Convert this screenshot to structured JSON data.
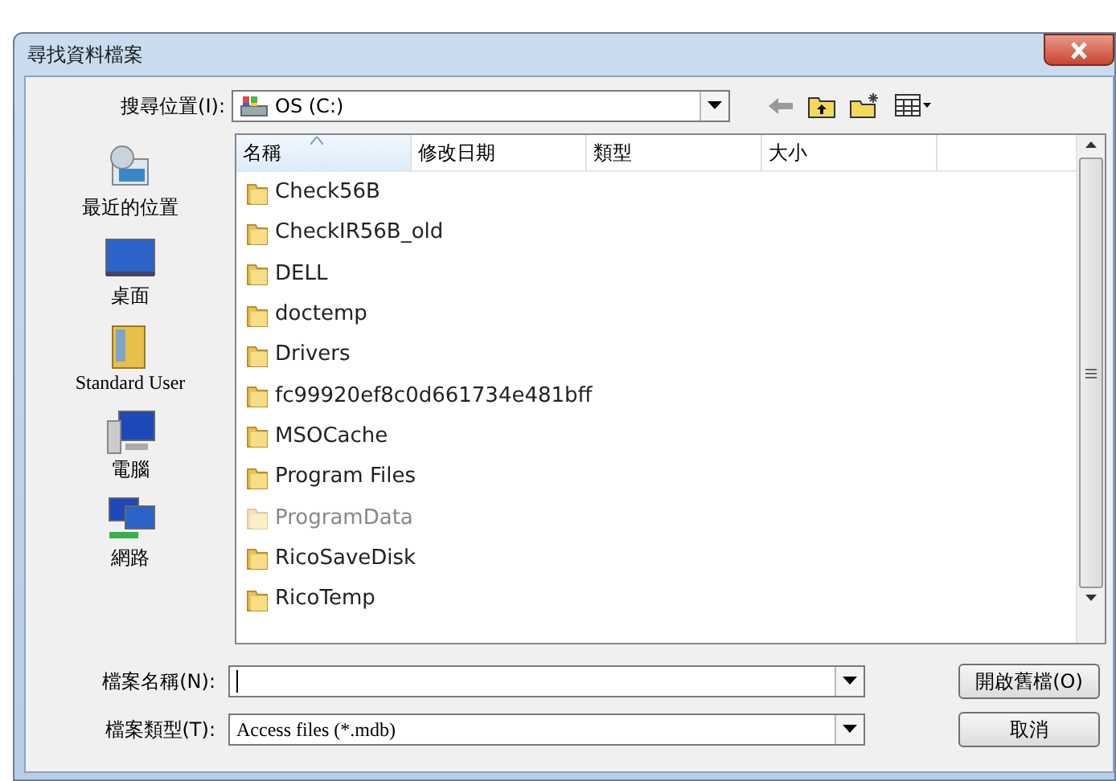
{
  "window": {
    "title": "尋找資料檔案"
  },
  "look_in": {
    "label": "搜尋位置(I):",
    "value": "OS (C:)"
  },
  "places": [
    {
      "label": "最近的位置",
      "kind": "recent"
    },
    {
      "label": "桌面",
      "kind": "desktop"
    },
    {
      "label": "Standard User",
      "kind": "user"
    },
    {
      "label": "電腦",
      "kind": "computer"
    },
    {
      "label": "網路",
      "kind": "network"
    }
  ],
  "columns": [
    {
      "label": "名稱",
      "sorted": true
    },
    {
      "label": "修改日期",
      "sorted": false
    },
    {
      "label": "類型",
      "sorted": false
    },
    {
      "label": "大小",
      "sorted": false
    }
  ],
  "files": [
    {
      "name": "Check56B",
      "hidden": false
    },
    {
      "name": "CheckIR56B_old",
      "hidden": false
    },
    {
      "name": "DELL",
      "hidden": false
    },
    {
      "name": "doctemp",
      "hidden": false
    },
    {
      "name": "Drivers",
      "hidden": false
    },
    {
      "name": "fc99920ef8c0d661734e481bff",
      "hidden": false
    },
    {
      "name": "MSOCache",
      "hidden": false
    },
    {
      "name": "Program Files",
      "hidden": false
    },
    {
      "name": "ProgramData",
      "hidden": true
    },
    {
      "name": "RicoSaveDisk",
      "hidden": false
    },
    {
      "name": "RicoTemp",
      "hidden": false
    }
  ],
  "file_name": {
    "label": "檔案名稱(N):"
  },
  "file_type": {
    "label": "檔案類型(T):",
    "value": "Access files (*.mdb)"
  },
  "buttons": [
    "開啟舊檔(O)",
    "取消"
  ]
}
